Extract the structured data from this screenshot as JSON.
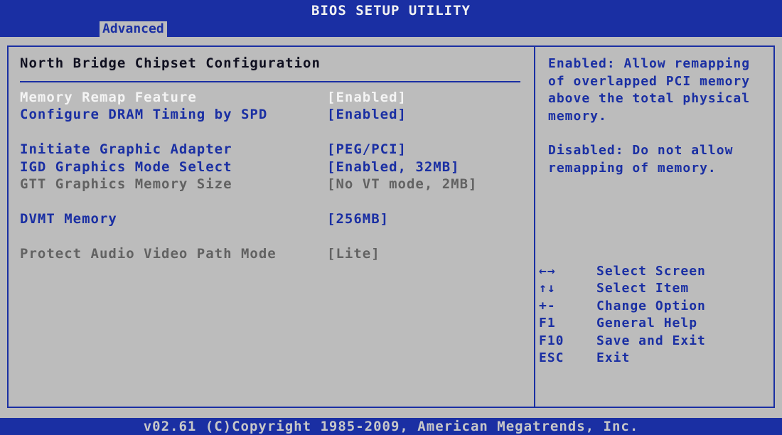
{
  "window": {
    "title": "BIOS SETUP UTILITY"
  },
  "tabs": [
    {
      "label": "Advanced",
      "active": true
    }
  ],
  "section": {
    "title": "North Bridge Chipset Configuration"
  },
  "settings": [
    {
      "label": "Memory Remap Feature",
      "value": "[Enabled]",
      "state": "selected"
    },
    {
      "label": "Configure DRAM Timing by SPD",
      "value": "[Enabled]",
      "state": "enabled"
    },
    {
      "label": "Initiate Graphic Adapter",
      "value": "[PEG/PCI]",
      "state": "enabled"
    },
    {
      "label": "IGD Graphics Mode Select",
      "value": "[Enabled, 32MB]",
      "state": "enabled"
    },
    {
      "label": "GTT Graphics Memory Size",
      "value": "[No VT mode, 2MB]",
      "state": "disabled"
    },
    {
      "label": "DVMT Memory",
      "value": "[256MB]",
      "state": "enabled"
    },
    {
      "label": "Protect Audio Video Path Mode",
      "value": "[Lite]",
      "state": "disabled"
    }
  ],
  "help": {
    "enabled_text": "Enabled: Allow remapping of overlapped PCI memory above the total physical memory.",
    "disabled_text": "Disabled: Do not allow remapping of memory."
  },
  "keys": [
    {
      "key": "←→",
      "desc": "Select Screen"
    },
    {
      "key": "↑↓",
      "desc": "Select Item"
    },
    {
      "key": "+-",
      "desc": "Change Option"
    },
    {
      "key": "F1",
      "desc": "General Help"
    },
    {
      "key": "F10",
      "desc": "Save and Exit"
    },
    {
      "key": "ESC",
      "desc": "Exit"
    }
  ],
  "footer": {
    "text": "v02.61 (C)Copyright 1985-2009, American Megatrends, Inc."
  },
  "colors": {
    "bios_blue": "#1a2fa3",
    "panel_gray": "#bcbcbc",
    "selected_white": "#f4f4f4",
    "disabled_gray": "#626262"
  }
}
